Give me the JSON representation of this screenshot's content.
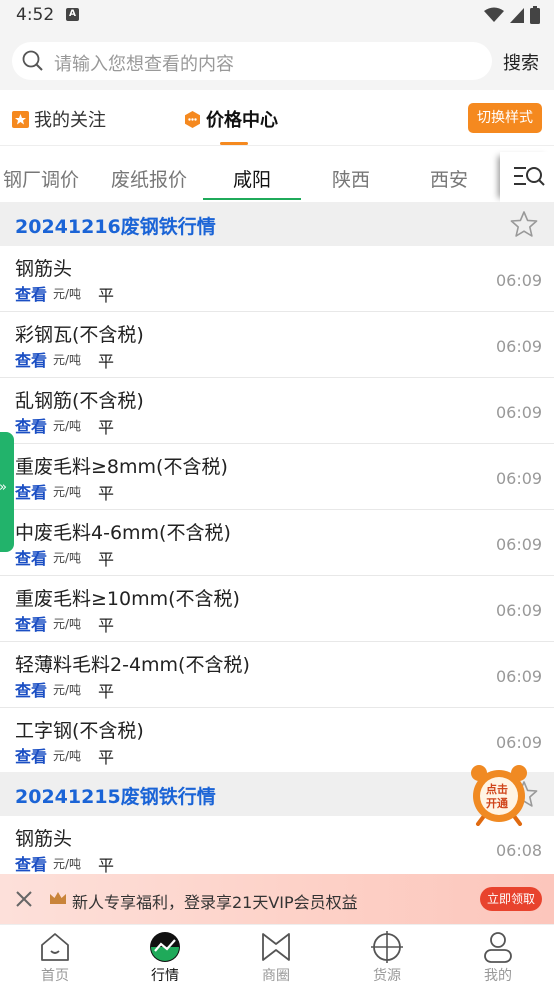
{
  "status": {
    "time": "4:52",
    "notif": "A"
  },
  "search": {
    "placeholder": "请输入您想查看的内容",
    "button": "搜索"
  },
  "top_tabs": {
    "follow": "我的关注",
    "price_center": "价格中心",
    "switch_style": "切换样式"
  },
  "region_tabs": [
    "钢厂调价",
    "废纸报价",
    "咸阳",
    "陕西",
    "西安"
  ],
  "sections": [
    {
      "title": "20241216废钢铁行情",
      "rows": [
        {
          "name": "钢筋头",
          "view": "查看",
          "unit": "元/吨",
          "trend": "平",
          "time": "06:09"
        },
        {
          "name": "彩钢瓦(不含税)",
          "view": "查看",
          "unit": "元/吨",
          "trend": "平",
          "time": "06:09"
        },
        {
          "name": "乱钢筋(不含税)",
          "view": "查看",
          "unit": "元/吨",
          "trend": "平",
          "time": "06:09"
        },
        {
          "name": "重废毛料≥8mm(不含税)",
          "view": "查看",
          "unit": "元/吨",
          "trend": "平",
          "time": "06:09"
        },
        {
          "name": "中废毛料4-6mm(不含税)",
          "view": "查看",
          "unit": "元/吨",
          "trend": "平",
          "time": "06:09"
        },
        {
          "name": "重废毛料≥10mm(不含税)",
          "view": "查看",
          "unit": "元/吨",
          "trend": "平",
          "time": "06:09"
        },
        {
          "name": "轻薄料毛料2-4mm(不含税)",
          "view": "查看",
          "unit": "元/吨",
          "trend": "平",
          "time": "06:09"
        },
        {
          "name": "工字钢(不含税)",
          "view": "查看",
          "unit": "元/吨",
          "trend": "平",
          "time": "06:09"
        }
      ]
    },
    {
      "title": "20241215废钢铁行情",
      "rows": [
        {
          "name": "钢筋头",
          "view": "查看",
          "unit": "元/吨",
          "trend": "平",
          "time": "06:08"
        }
      ]
    }
  ],
  "floating_badge": {
    "line1": "点击",
    "line2": "开通"
  },
  "promo": {
    "text": "新人专享福利，登录享21天VIP会员权益",
    "button": "立即领取"
  },
  "nav": [
    "首页",
    "行情",
    "商圈",
    "货源",
    "我的"
  ],
  "colors": {
    "accent_orange": "#f5891f",
    "accent_green": "#1faa5a",
    "link_blue": "#1b64d6",
    "promo_red": "#e8432d"
  }
}
